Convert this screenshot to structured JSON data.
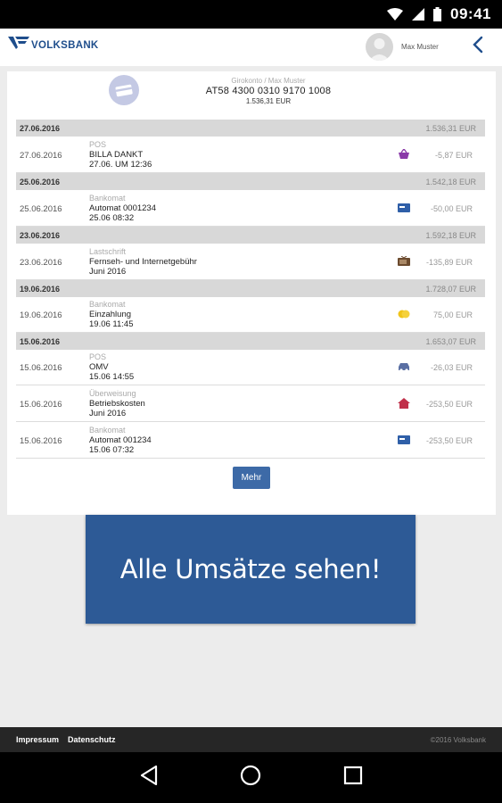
{
  "status": {
    "time": "09:41"
  },
  "header": {
    "brand": "VOLKSBANK",
    "user_name": "Max Muster"
  },
  "account": {
    "name": "Girokonto / Max Muster",
    "iban": "AT58 4300 0310 9170 1008",
    "balance": "1.536,31 EUR"
  },
  "groups": [
    {
      "date": "27.06.2016",
      "balance": "1.536,31 EUR",
      "transactions": [
        {
          "date": "27.06.2016",
          "type": "POS",
          "desc": "BILLA DANKT",
          "sub": "27.06. UM 12:36",
          "icon": "basket-icon",
          "amount": "-5,87 EUR"
        }
      ]
    },
    {
      "date": "25.06.2016",
      "balance": "1.542,18 EUR",
      "transactions": [
        {
          "date": "25.06.2016",
          "type": "Bankomat",
          "desc": "Automat 0001234",
          "sub": "25.06 08:32",
          "icon": "card-icon",
          "amount": "-50,00 EUR"
        }
      ]
    },
    {
      "date": "23.06.2016",
      "balance": "1.592,18 EUR",
      "transactions": [
        {
          "date": "23.06.2016",
          "type": "Lastschrift",
          "desc": "Fernseh- und Internetgebühr",
          "sub": "Juni 2016",
          "icon": "tv-icon",
          "amount": "-135,89 EUR"
        }
      ]
    },
    {
      "date": "19.06.2016",
      "balance": "1.728,07 EUR",
      "transactions": [
        {
          "date": "19.06.2016",
          "type": "Bankomat",
          "desc": "Einzahlung",
          "sub": "19.06 11:45",
          "icon": "coins-icon",
          "amount": "75,00 EUR"
        }
      ]
    },
    {
      "date": "15.06.2016",
      "balance": "1.653,07 EUR",
      "transactions": [
        {
          "date": "15.06.2016",
          "type": "POS",
          "desc": "OMV",
          "sub": "15.06 14:55",
          "icon": "car-icon",
          "amount": "-26,03 EUR"
        },
        {
          "date": "15.06.2016",
          "type": "Überweisung",
          "desc": "Betriebskosten",
          "sub": "Juni 2016",
          "icon": "house-icon",
          "amount": "-253,50 EUR"
        },
        {
          "date": "15.06.2016",
          "type": "Bankomat",
          "desc": "Automat 001234",
          "sub": "15.06 07:32",
          "icon": "card-icon",
          "amount": "-253,50 EUR"
        }
      ]
    }
  ],
  "more_label": "Mehr",
  "banner_text": "Alle Umsätze sehen!",
  "footer": {
    "impressum": "Impressum",
    "datenschutz": "Datenschutz",
    "copyright": "©2016 Volksbank"
  },
  "colors": {
    "brand": "#1f4e8c",
    "button": "#3d6aa7",
    "banner": "#2d5a96"
  }
}
